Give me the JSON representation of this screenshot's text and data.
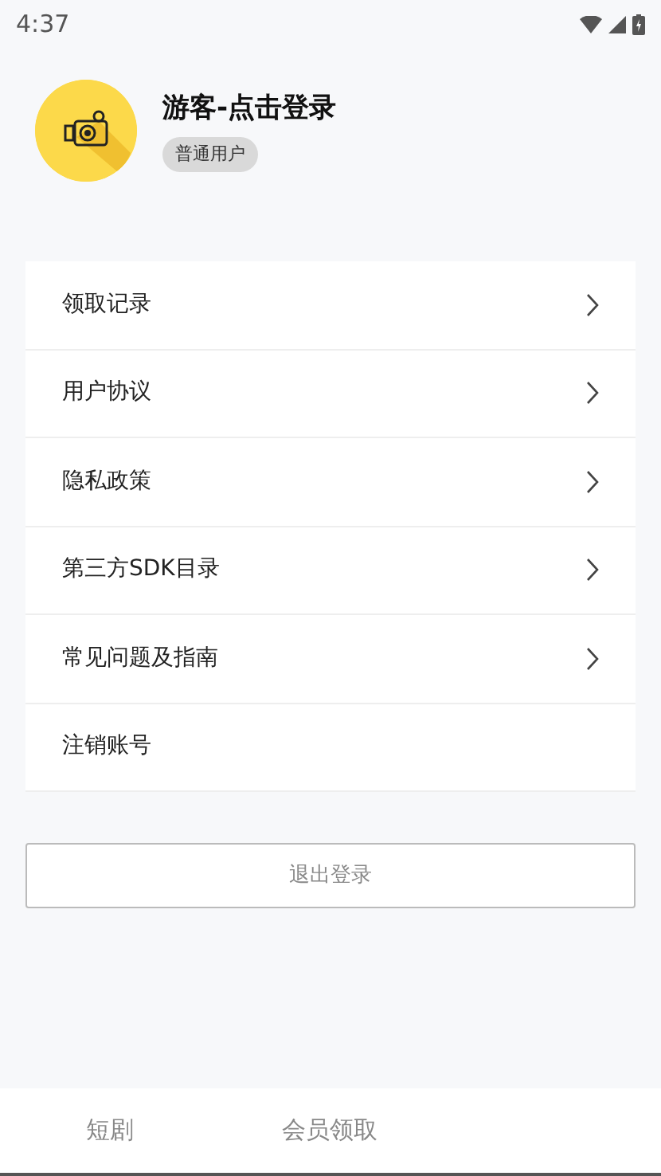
{
  "status_bar": {
    "time": "4:37"
  },
  "profile": {
    "name": "游客-点击登录",
    "badge": "普通用户"
  },
  "menu": [
    {
      "label": "领取记录",
      "has_arrow": true
    },
    {
      "label": "用户协议",
      "has_arrow": true
    },
    {
      "label": "隐私政策",
      "has_arrow": true
    },
    {
      "label": "第三方SDK目录",
      "has_arrow": true
    },
    {
      "label": "常见问题及指南",
      "has_arrow": true
    },
    {
      "label": "注销账号",
      "has_arrow": false
    }
  ],
  "logout_button": "退出登录",
  "tabs": [
    {
      "label": "短剧",
      "selected": false
    },
    {
      "label": "会员领取",
      "selected": false
    }
  ]
}
